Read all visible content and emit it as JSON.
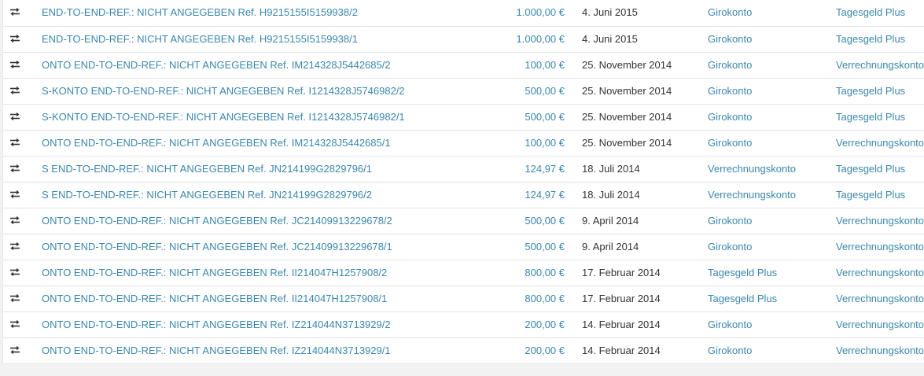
{
  "icons": {
    "row_icon": "transfer-arrows-icon"
  },
  "colors": {
    "link": "#3a87ad",
    "text": "#333333"
  },
  "transactions": [
    {
      "description": "END-TO-END-REF.: NICHT ANGEGEBEN Ref. H9215155I5159938/2",
      "amount": "1.000,00 €",
      "date": "4. Juni 2015",
      "from": "Girokonto",
      "to": "Tagesgeld Plus"
    },
    {
      "description": "END-TO-END-REF.: NICHT ANGEGEBEN Ref. H9215155I5159938/1",
      "amount": "1.000,00 €",
      "date": "4. Juni 2015",
      "from": "Girokonto",
      "to": "Tagesgeld Plus"
    },
    {
      "description": "ONTO END-TO-END-REF.: NICHT ANGEGEBEN Ref. IM214328J5442685/2",
      "amount": "100,00 €",
      "date": "25. November 2014",
      "from": "Girokonto",
      "to": "Verrechnungskonto"
    },
    {
      "description": "S-KONTO END-TO-END-REF.: NICHT ANGEGEBEN Ref. I1214328J5746982/2",
      "amount": "500,00 €",
      "date": "25. November 2014",
      "from": "Girokonto",
      "to": "Tagesgeld Plus"
    },
    {
      "description": "S-KONTO END-TO-END-REF.: NICHT ANGEGEBEN Ref. I1214328J5746982/1",
      "amount": "500,00 €",
      "date": "25. November 2014",
      "from": "Girokonto",
      "to": "Tagesgeld Plus"
    },
    {
      "description": "ONTO END-TO-END-REF.: NICHT ANGEGEBEN Ref. IM214328J5442685/1",
      "amount": "100,00 €",
      "date": "25. November 2014",
      "from": "Girokonto",
      "to": "Verrechnungskonto"
    },
    {
      "description": "S END-TO-END-REF.: NICHT ANGEGEBEN Ref. JN214199G2829796/1",
      "amount": "124,97 €",
      "date": "18. Juli 2014",
      "from": "Verrechnungskonto",
      "to": "Tagesgeld Plus"
    },
    {
      "description": "S END-TO-END-REF.: NICHT ANGEGEBEN Ref. JN214199G2829796/2",
      "amount": "124,97 €",
      "date": "18. Juli 2014",
      "from": "Verrechnungskonto",
      "to": "Tagesgeld Plus"
    },
    {
      "description": "ONTO END-TO-END-REF.: NICHT ANGEGEBEN Ref. JC21409913229678/2",
      "amount": "500,00 €",
      "date": "9. April 2014",
      "from": "Girokonto",
      "to": "Verrechnungskonto"
    },
    {
      "description": "ONTO END-TO-END-REF.: NICHT ANGEGEBEN Ref. JC21409913229678/1",
      "amount": "500,00 €",
      "date": "9. April 2014",
      "from": "Girokonto",
      "to": "Verrechnungskonto"
    },
    {
      "description": "ONTO END-TO-END-REF.: NICHT ANGEGEBEN Ref. II214047H1257908/2",
      "amount": "800,00 €",
      "date": "17. Februar 2014",
      "from": "Tagesgeld Plus",
      "to": "Verrechnungskonto"
    },
    {
      "description": "ONTO END-TO-END-REF.: NICHT ANGEGEBEN Ref. II214047H1257908/1",
      "amount": "800,00 €",
      "date": "17. Februar 2014",
      "from": "Tagesgeld Plus",
      "to": "Verrechnungskonto"
    },
    {
      "description": "ONTO END-TO-END-REF.: NICHT ANGEGEBEN Ref. IZ214044N3713929/2",
      "amount": "200,00 €",
      "date": "14. Februar 2014",
      "from": "Girokonto",
      "to": "Verrechnungskonto"
    },
    {
      "description": "ONTO END-TO-END-REF.: NICHT ANGEGEBEN Ref. IZ214044N3713929/1",
      "amount": "200,00 €",
      "date": "14. Februar 2014",
      "from": "Girokonto",
      "to": "Verrechnungskonto"
    }
  ]
}
